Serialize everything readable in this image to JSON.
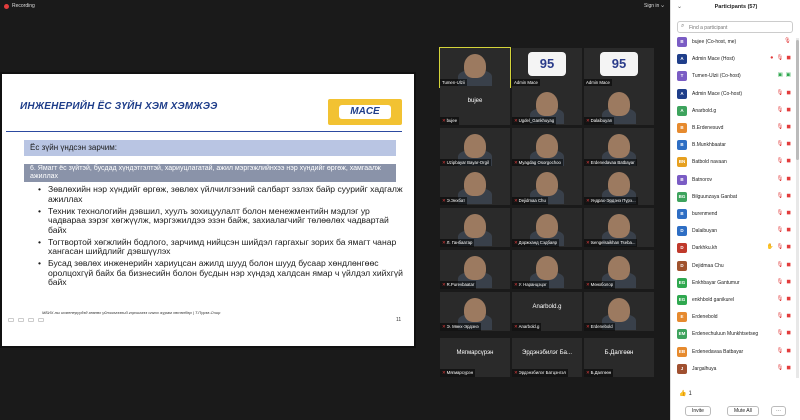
{
  "topbar": {
    "recording": "Recording",
    "sign_in": "Sign in",
    "minimize_icon": "minimize-icon"
  },
  "slide": {
    "title": "ИНЖЕНЕРИЙН ЁС ЗҮЙН ХЭМ ХЭМЖЭЭ",
    "logo": "MACE",
    "subhead": "Ёс зүйн үндсэн зарчим:",
    "principle": "6. Ямагт ёс зүйтэй, бусдад хүндэтгэлтэй, хариуцлагатай, ажил мэргэжлийнхээ нэр хүндийг өргөж, хамгаалж ажиллах",
    "bullets": [
      "Зөвлөхийн нэр хүндийг өргөж, зөвлөх үйлчилгээний салбарт эзлэх байр суурийг хадгалж ажиллах",
      "Техник технологийн дэвшил, хуулъ зохицуулалт болон менежментийн мэдлэг ур чадвараа зэрэг хөгжүүлж, мэргэжилдээ эзэн байж, захиалагчийг төлөөлөх чадвартай байх",
      "Тогтвортой хөгжлийн бодлого, зарчимд нийцсэн шийдэл гаргахыг зорих ба ямагт чанар хангасан шийдлийг дэвшүүлэх",
      "Бусад зөвлөх инженерийн хариуцсан ажилд шууд болон шууд бусаар хөндлөнгөөс оролцохгүй байх ба бизнесийн болон бусдын нэр хүндэд халдсан ямар ч үйлдэл хийхгүй байх"
    ],
    "footer": "МБИХ-ны инженерүүдэд зөвлөх үйлчилгээний гэрчилгээ олгох журам хөтөлбөр | Т.Пүрэв-Очир",
    "page": "11"
  },
  "videos": [
    {
      "name": "Tumen-Ulzii",
      "type": "face",
      "active": true,
      "muted": false
    },
    {
      "name": "Admin Mace",
      "type": "logo95",
      "muted": false
    },
    {
      "name": "Admin Mace",
      "type": "logo95",
      "muted": false
    },
    {
      "name": "bujee",
      "type": "text",
      "big": "bujee",
      "muted": true
    },
    {
      "name": "Ugdel_Gankhuyag",
      "type": "face",
      "muted": true
    },
    {
      "name": "Dalaibuyan",
      "type": "face",
      "muted": true
    },
    {
      "name": "Uzipbayar Bayar-Orgil",
      "type": "face",
      "muted": true
    },
    {
      "name": "Myagdag Osorgochoo",
      "type": "face",
      "muted": true
    },
    {
      "name": "Erdenedavaa Batbayar",
      "type": "face",
      "muted": true
    },
    {
      "name": "Э.Энхбат",
      "type": "face",
      "muted": true
    },
    {
      "name": "Dejidmaa Chu",
      "type": "face",
      "muted": true
    },
    {
      "name": "Ундрах-Эрдэнэ Пүрэ...",
      "type": "face",
      "muted": true
    },
    {
      "name": "Л. Ганбаатар",
      "type": "face",
      "muted": true
    },
    {
      "name": "Доржханд Сэдбаяр",
      "type": "face",
      "muted": true
    },
    {
      "name": "tsengelsaikhan Tseba...",
      "type": "face",
      "muted": true
    },
    {
      "name": "R.Purevbaatar",
      "type": "face",
      "muted": true
    },
    {
      "name": "У. Наранцэцэг",
      "type": "face",
      "muted": true
    },
    {
      "name": "Мөнхболор",
      "type": "face",
      "muted": true
    },
    {
      "name": "Э. Мөнх-Эрдэнэ",
      "type": "face",
      "muted": true
    },
    {
      "name": "Anarbold.g",
      "type": "text",
      "big": "Anarbold.g",
      "muted": true
    },
    {
      "name": "Erdenebold",
      "type": "face",
      "muted": true
    },
    {
      "name": "Мягмарсүрэн",
      "type": "text",
      "big": "Мягмарсүрэн",
      "muted": true
    },
    {
      "name": "Эрдэнэбилэг Батцэнгэл",
      "type": "text",
      "big": "Эрдэнэбилэг Ба...",
      "muted": true
    },
    {
      "name": "Б.Далгөөн",
      "type": "text",
      "big": "Б.Далгөөн",
      "muted": true
    }
  ],
  "panel": {
    "title": "Participants (57)",
    "search_placeholder": "Find a participant",
    "reaction_count": "1",
    "invite": "Invite",
    "mute_all": "Mute All",
    "participants": [
      {
        "initial": "B",
        "name": "bujee (Co-host, me)",
        "color": "#7a5cc4",
        "icons": [
          "mic"
        ]
      },
      {
        "initial": "A",
        "name": "Admin Mace (Host)",
        "color": "#1f3e8a",
        "icons": [
          "rec",
          "mic",
          "cam"
        ]
      },
      {
        "initial": "T",
        "name": "Tumen-Ulzii (Co-host)",
        "color": "#7a5cc4",
        "icons": [
          "green",
          "green"
        ]
      },
      {
        "initial": "A",
        "name": "Admin Mace (Co-host)",
        "color": "#1f3e8a",
        "icons": [
          "mic",
          "cam"
        ]
      },
      {
        "initial": "A",
        "name": "Anarbold.g",
        "color": "#3da35d",
        "icons": [
          "mic",
          "cam"
        ]
      },
      {
        "initial": "B",
        "name": "B.Erdenesuvd",
        "color": "#e68a2e",
        "icons": [
          "mic",
          "cam"
        ]
      },
      {
        "initial": "B",
        "name": "B.Munkhbaatar",
        "color": "#2e6ec4",
        "icons": [
          "mic",
          "cam"
        ]
      },
      {
        "initial": "BN",
        "name": "Batbold navaan",
        "color": "#e6a020",
        "icons": [
          "mic",
          "cam"
        ]
      },
      {
        "initial": "B",
        "name": "Batnorov",
        "color": "#7a5cc4",
        "icons": [
          "mic",
          "cam"
        ]
      },
      {
        "initial": "BG",
        "name": "Bilguunzaya Ganbat",
        "color": "#3da35d",
        "icons": [
          "mic",
          "cam"
        ]
      },
      {
        "initial": "B",
        "name": "burenmend",
        "color": "#2e6ec4",
        "icons": [
          "mic",
          "cam"
        ]
      },
      {
        "initial": "D",
        "name": "Dalaibuyan",
        "color": "#2e6ec4",
        "icons": [
          "mic",
          "cam"
        ]
      },
      {
        "initial": "D",
        "name": "Darkhku.kh",
        "color": "#c0392b",
        "icons": [
          "hand",
          "mic",
          "cam"
        ]
      },
      {
        "initial": "D",
        "name": "Dejidmaa Chu",
        "color": "#a0522d",
        "icons": [
          "mic",
          "cam"
        ]
      },
      {
        "initial": "EG",
        "name": "Enkhbayar Gantumur",
        "color": "#2fa84f",
        "icons": [
          "mic",
          "cam"
        ]
      },
      {
        "initial": "EG",
        "name": "enkhbold ganikurel",
        "color": "#2fa84f",
        "icons": [
          "mic",
          "cam"
        ]
      },
      {
        "initial": "E",
        "name": "Erdenebold",
        "color": "#e68a2e",
        "icons": [
          "mic",
          "cam"
        ]
      },
      {
        "initial": "EM",
        "name": "Erdenechuluun Munkhtsetseg",
        "color": "#3da35d",
        "icons": [
          "mic",
          "cam"
        ]
      },
      {
        "initial": "EB",
        "name": "Erdenedavaa Batbayar",
        "color": "#e68a2e",
        "icons": [
          "mic",
          "cam"
        ]
      },
      {
        "initial": "J",
        "name": "Jargalhuya",
        "color": "#a05030",
        "icons": [
          "mic",
          "cam"
        ]
      }
    ]
  }
}
